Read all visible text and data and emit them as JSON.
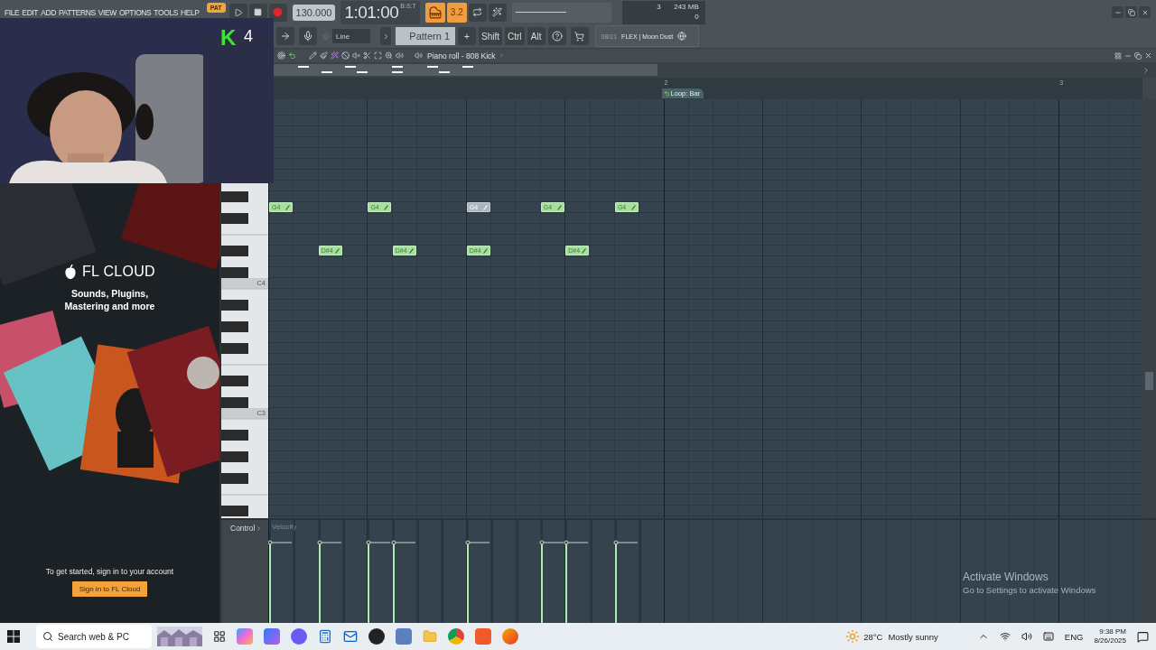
{
  "menu": [
    "FILE",
    "EDIT",
    "ADD",
    "PATTERNS",
    "VIEW",
    "OPTIONS",
    "TOOLS",
    "HELP"
  ],
  "transport": {
    "mode": "PAT",
    "tempo": "130.000",
    "time": "1:01:00",
    "time_format": "B:S:T",
    "snap_toggle": "3.2"
  },
  "monitor": {
    "cpu": "3",
    "memory": "243 MB",
    "polyphony": "0"
  },
  "toolbar": {
    "snap": "Line",
    "pattern": "Pattern 1",
    "add": "+",
    "modifier_keys": [
      "Shift",
      "Ctrl",
      "Alt"
    ],
    "news": {
      "date": "08/21",
      "title": "FLEX | Moon Dust"
    }
  },
  "webcam": {
    "kind": "picture",
    "logo": "K",
    "count": "4"
  },
  "browser": {
    "title": "FL CLOUD",
    "tagline": [
      "Sounds, Plugins,",
      "Mastering and more"
    ],
    "prompt": "To get started, sign in to your account",
    "button": "Sign in to FL Cloud"
  },
  "piano_roll": {
    "title": "Piano roll - 808 Kick",
    "ruler": [
      "2",
      "3"
    ],
    "loop_marker": "Loop: Bar",
    "key_labels": [
      "C4",
      "C3"
    ],
    "steps": [
      {
        "rest": false,
        "notes": [
          {
            "label": "G4",
            "muted": false
          }
        ],
        "level": 0.78
      },
      {
        "rest": true
      },
      {
        "rest": false,
        "notes": [
          {
            "label": "D#4",
            "muted": false
          }
        ],
        "level": 0.78
      },
      {
        "rest": true
      },
      {
        "rest": false,
        "notes": [
          {
            "label": "G4",
            "muted": false
          }
        ],
        "level": 0.78
      },
      {
        "rest": false,
        "notes": [
          {
            "label": "D#4",
            "muted": false
          }
        ],
        "level": 0.78
      },
      {
        "rest": true
      },
      {
        "rest": true
      },
      {
        "rest": false,
        "notes": [
          {
            "label": "G4",
            "muted": true
          },
          {
            "label": "D#4",
            "muted": false
          }
        ],
        "level": 0.78
      },
      {
        "rest": true
      },
      {
        "rest": true
      },
      {
        "rest": false,
        "notes": [
          {
            "label": "G4",
            "muted": false
          }
        ],
        "level": 0.78
      },
      {
        "rest": false,
        "notes": [
          {
            "label": "D#4",
            "muted": false
          }
        ],
        "level": 0.78
      },
      {
        "rest": true
      },
      {
        "rest": false,
        "notes": [
          {
            "label": "G4",
            "muted": false
          }
        ],
        "level": 0.78
      },
      {
        "rest": true
      }
    ],
    "control": {
      "label": "Control",
      "parameter": "Velocity"
    }
  },
  "activation_notice": {
    "title": "Activate Windows",
    "text": "Go to Settings to activate Windows"
  },
  "taskbar": {
    "search_placeholder": "Search web & PC",
    "weather": {
      "temperature": "28°C",
      "condition": "Mostly sunny"
    },
    "language": "ENG",
    "time": "9:38 PM",
    "date": "8/26/2025"
  }
}
